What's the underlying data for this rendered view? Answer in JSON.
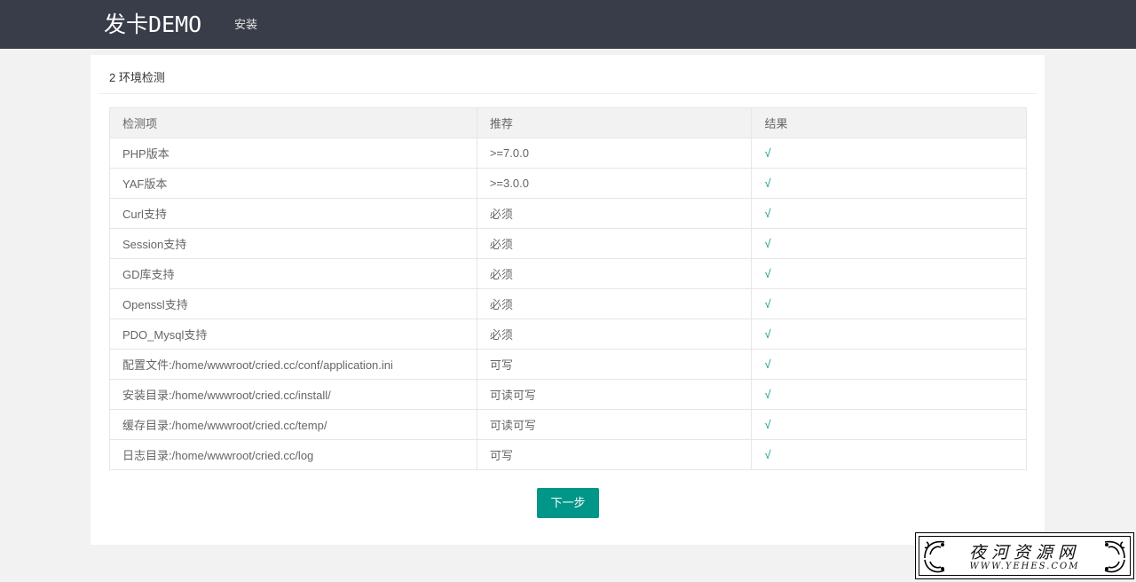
{
  "header": {
    "brand": "发卡DEMO",
    "nav": [
      {
        "label": "安装"
      }
    ]
  },
  "panel": {
    "title": "2 环境检测",
    "table": {
      "headers": [
        "检测项",
        "推荐",
        "结果"
      ],
      "rows": [
        {
          "item": "PHP版本",
          "recommend": ">=7.0.0",
          "result": "√"
        },
        {
          "item": "YAF版本",
          "recommend": ">=3.0.0",
          "result": "√"
        },
        {
          "item": "Curl支持",
          "recommend": "必须",
          "result": "√"
        },
        {
          "item": "Session支持",
          "recommend": "必须",
          "result": "√"
        },
        {
          "item": "GD库支持",
          "recommend": "必须",
          "result": "√"
        },
        {
          "item": "Openssl支持",
          "recommend": "必须",
          "result": "√"
        },
        {
          "item": "PDO_Mysql支持",
          "recommend": "必须",
          "result": "√"
        },
        {
          "item": "配置文件:/home/wwwroot/cried.cc/conf/application.ini",
          "recommend": "可写",
          "result": "√"
        },
        {
          "item": "安装目录:/home/wwwroot/cried.cc/install/",
          "recommend": "可读可写",
          "result": "√"
        },
        {
          "item": "缓存目录:/home/wwwroot/cried.cc/temp/",
          "recommend": "可读可写",
          "result": "√"
        },
        {
          "item": "日志目录:/home/wwwroot/cried.cc/log",
          "recommend": "可写",
          "result": "√"
        }
      ]
    },
    "next_button": "下一步"
  },
  "watermark": {
    "title": "夜河资源网",
    "url": "WWW.YEHES.COM"
  },
  "colors": {
    "topbar": "#393d49",
    "accent": "#009688",
    "background": "#f2f2f2"
  }
}
